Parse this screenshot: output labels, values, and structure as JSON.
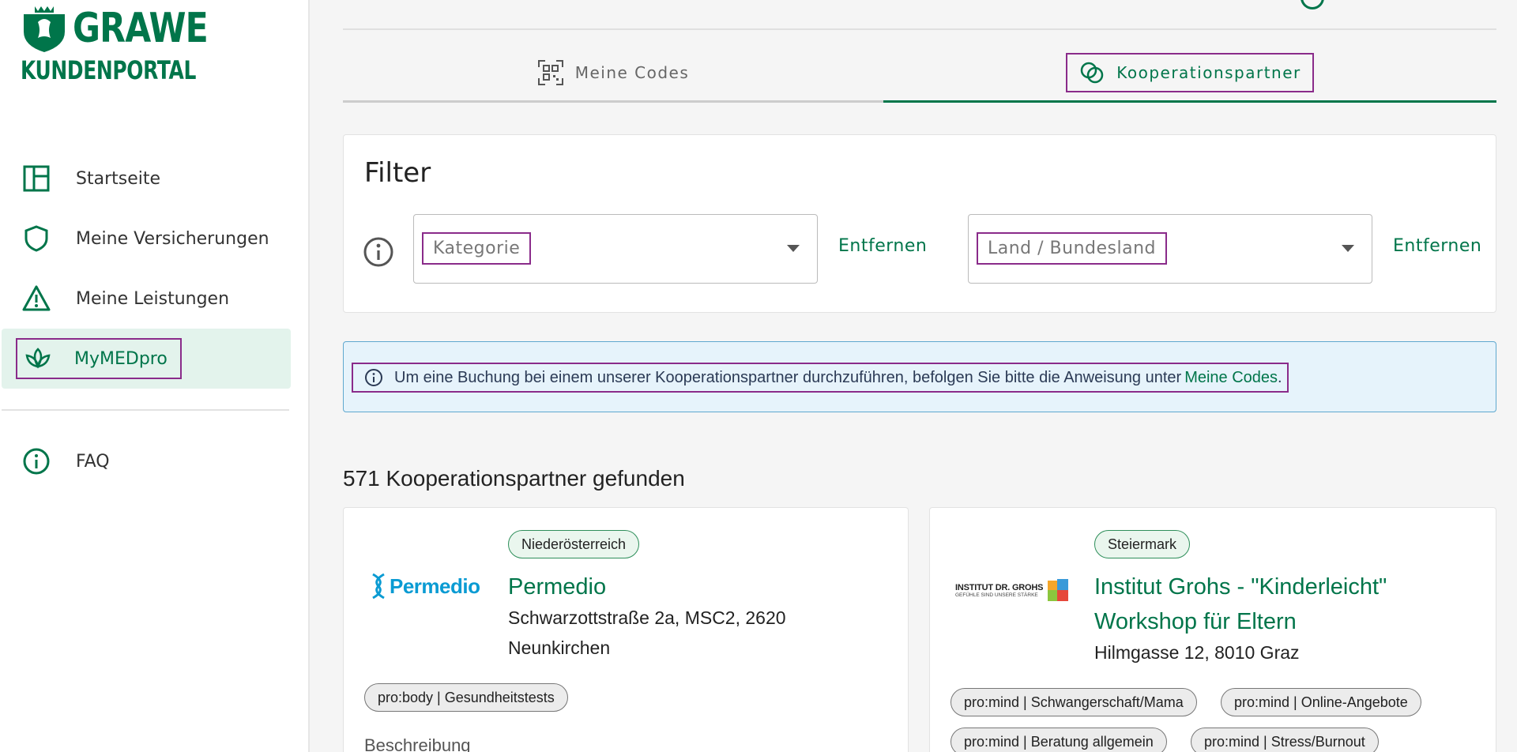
{
  "brand": {
    "logo_top": "GRAWE",
    "logo_sub": "KUNDENPORTAL",
    "primary_color": "#00754a",
    "highlight_color": "#8a2b8a"
  },
  "sidebar": {
    "items": [
      {
        "label": "Startseite",
        "icon": "dashboard-icon"
      },
      {
        "label": "Meine Versicherungen",
        "icon": "shield-icon"
      },
      {
        "label": "Meine Leistungen",
        "icon": "warning-icon"
      },
      {
        "label": "MyMEDpro",
        "icon": "lotus-icon",
        "active": true
      }
    ],
    "faq": {
      "label": "FAQ",
      "icon": "info-icon"
    }
  },
  "tabs": [
    {
      "label": "Meine Codes",
      "icon": "qr-code-icon"
    },
    {
      "label": "Kooperationspartner",
      "icon": "link-circles-icon",
      "active": true
    }
  ],
  "filter": {
    "title": "Filter",
    "category_placeholder": "Kategorie",
    "region_placeholder": "Land / Bundesland",
    "remove_label": "Entfernen"
  },
  "banner": {
    "text": "Um eine Buchung bei einem unserer Kooperationspartner durchzuführen, befolgen Sie bitte die Anweisung unter",
    "link": "Meine Codes",
    "suffix": "."
  },
  "results": {
    "count_text": "571 Kooperationspartner gefunden"
  },
  "partners": [
    {
      "region": "Niederösterreich",
      "name": "Permedio",
      "logo_text": "Permedio",
      "address_line1": "Schwarzottstraße 2a, MSC2, 2620",
      "address_line2": "Neunkirchen",
      "tags": [
        "pro:body | Gesundheitstests"
      ],
      "description_label": "Beschreibung"
    },
    {
      "region": "Steiermark",
      "name_line1": "Institut Grohs - \"Kinderleicht\"",
      "name_line2": "Workshop für Eltern",
      "logo_line1": "INSTITUT DR. GROHS",
      "logo_line2": "GEFÜHLE SIND UNSERE STÄRKE",
      "address_line1": "Hilmgasse 12, 8010 Graz",
      "tags": [
        "pro:mind | Schwangerschaft/Mama",
        "pro:mind | Online-Angebote",
        "pro:mind | Beratung allgemein",
        "pro:mind | Stress/Burnout"
      ]
    }
  ]
}
